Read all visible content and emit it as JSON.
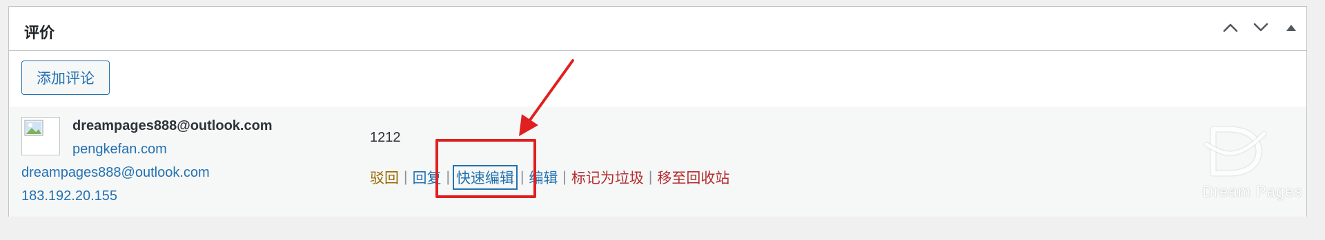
{
  "panel": {
    "title": "评价",
    "controls": {
      "move_up_icon": "chevron-up-icon",
      "move_down_icon": "chevron-down-icon",
      "toggle_icon": "triangle-up-icon"
    }
  },
  "add_comment": {
    "label": "添加评论"
  },
  "comment": {
    "avatar_icon": "broken-image-icon",
    "author_name": "dreampages888@outlook.com",
    "author_url": "pengkefan.com",
    "author_email": "dreampages888@outlook.com",
    "author_ip": "183.192.20.155",
    "text": "1212",
    "actions": {
      "unapprove": "驳回",
      "reply": "回复",
      "quick_edit": "快速编辑",
      "edit": "编辑",
      "spam": "标记为垃圾",
      "trash": "移至回收站",
      "separator": "|"
    }
  },
  "annotation": {
    "color": "#e02020",
    "highlight_target": "快速编辑"
  },
  "watermark": {
    "text": "Dream Pages",
    "logo_icon": "dreampages-logo-icon"
  },
  "colors": {
    "link": "#2271b1",
    "unapprove": "#996800",
    "danger": "#b32d2e",
    "row_background": "#f6f7f7",
    "page_background": "#f0f0f1"
  }
}
